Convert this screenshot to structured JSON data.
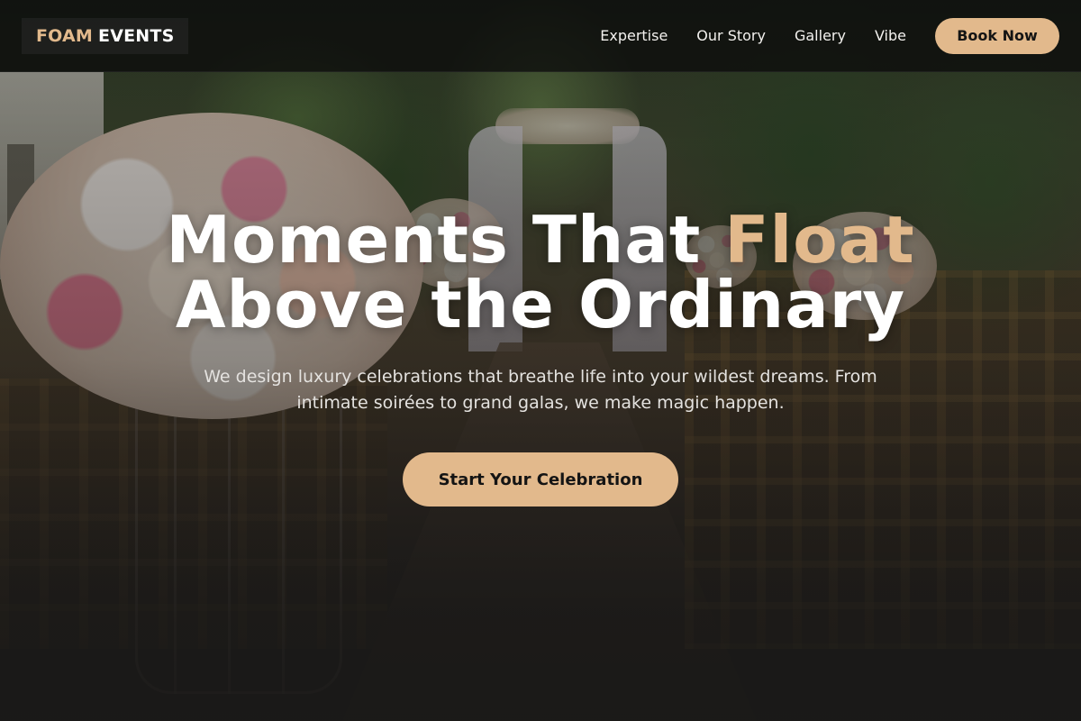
{
  "brand": {
    "accent_word": "FOAM",
    "rest": "EVENTS"
  },
  "nav": {
    "links": [
      {
        "label": "Expertise"
      },
      {
        "label": "Our Story"
      },
      {
        "label": "Gallery"
      },
      {
        "label": "Vibe"
      }
    ],
    "book_button": "Book Now"
  },
  "hero": {
    "title_line1_plain": "Moments That ",
    "title_line1_accent": "Float",
    "title_line2": "Above the Ordinary",
    "subtitle": "We design luxury celebrations that breathe life into your wildest dreams. From intimate soirées to grand galas, we make magic happen.",
    "cta": "Start Your Celebration",
    "background_image": "wedding-aisle-with-flower-bouquets"
  },
  "colors": {
    "accent": "#e2b98c",
    "nav_bg": "#0c0c0c",
    "text": "#ffffff"
  }
}
